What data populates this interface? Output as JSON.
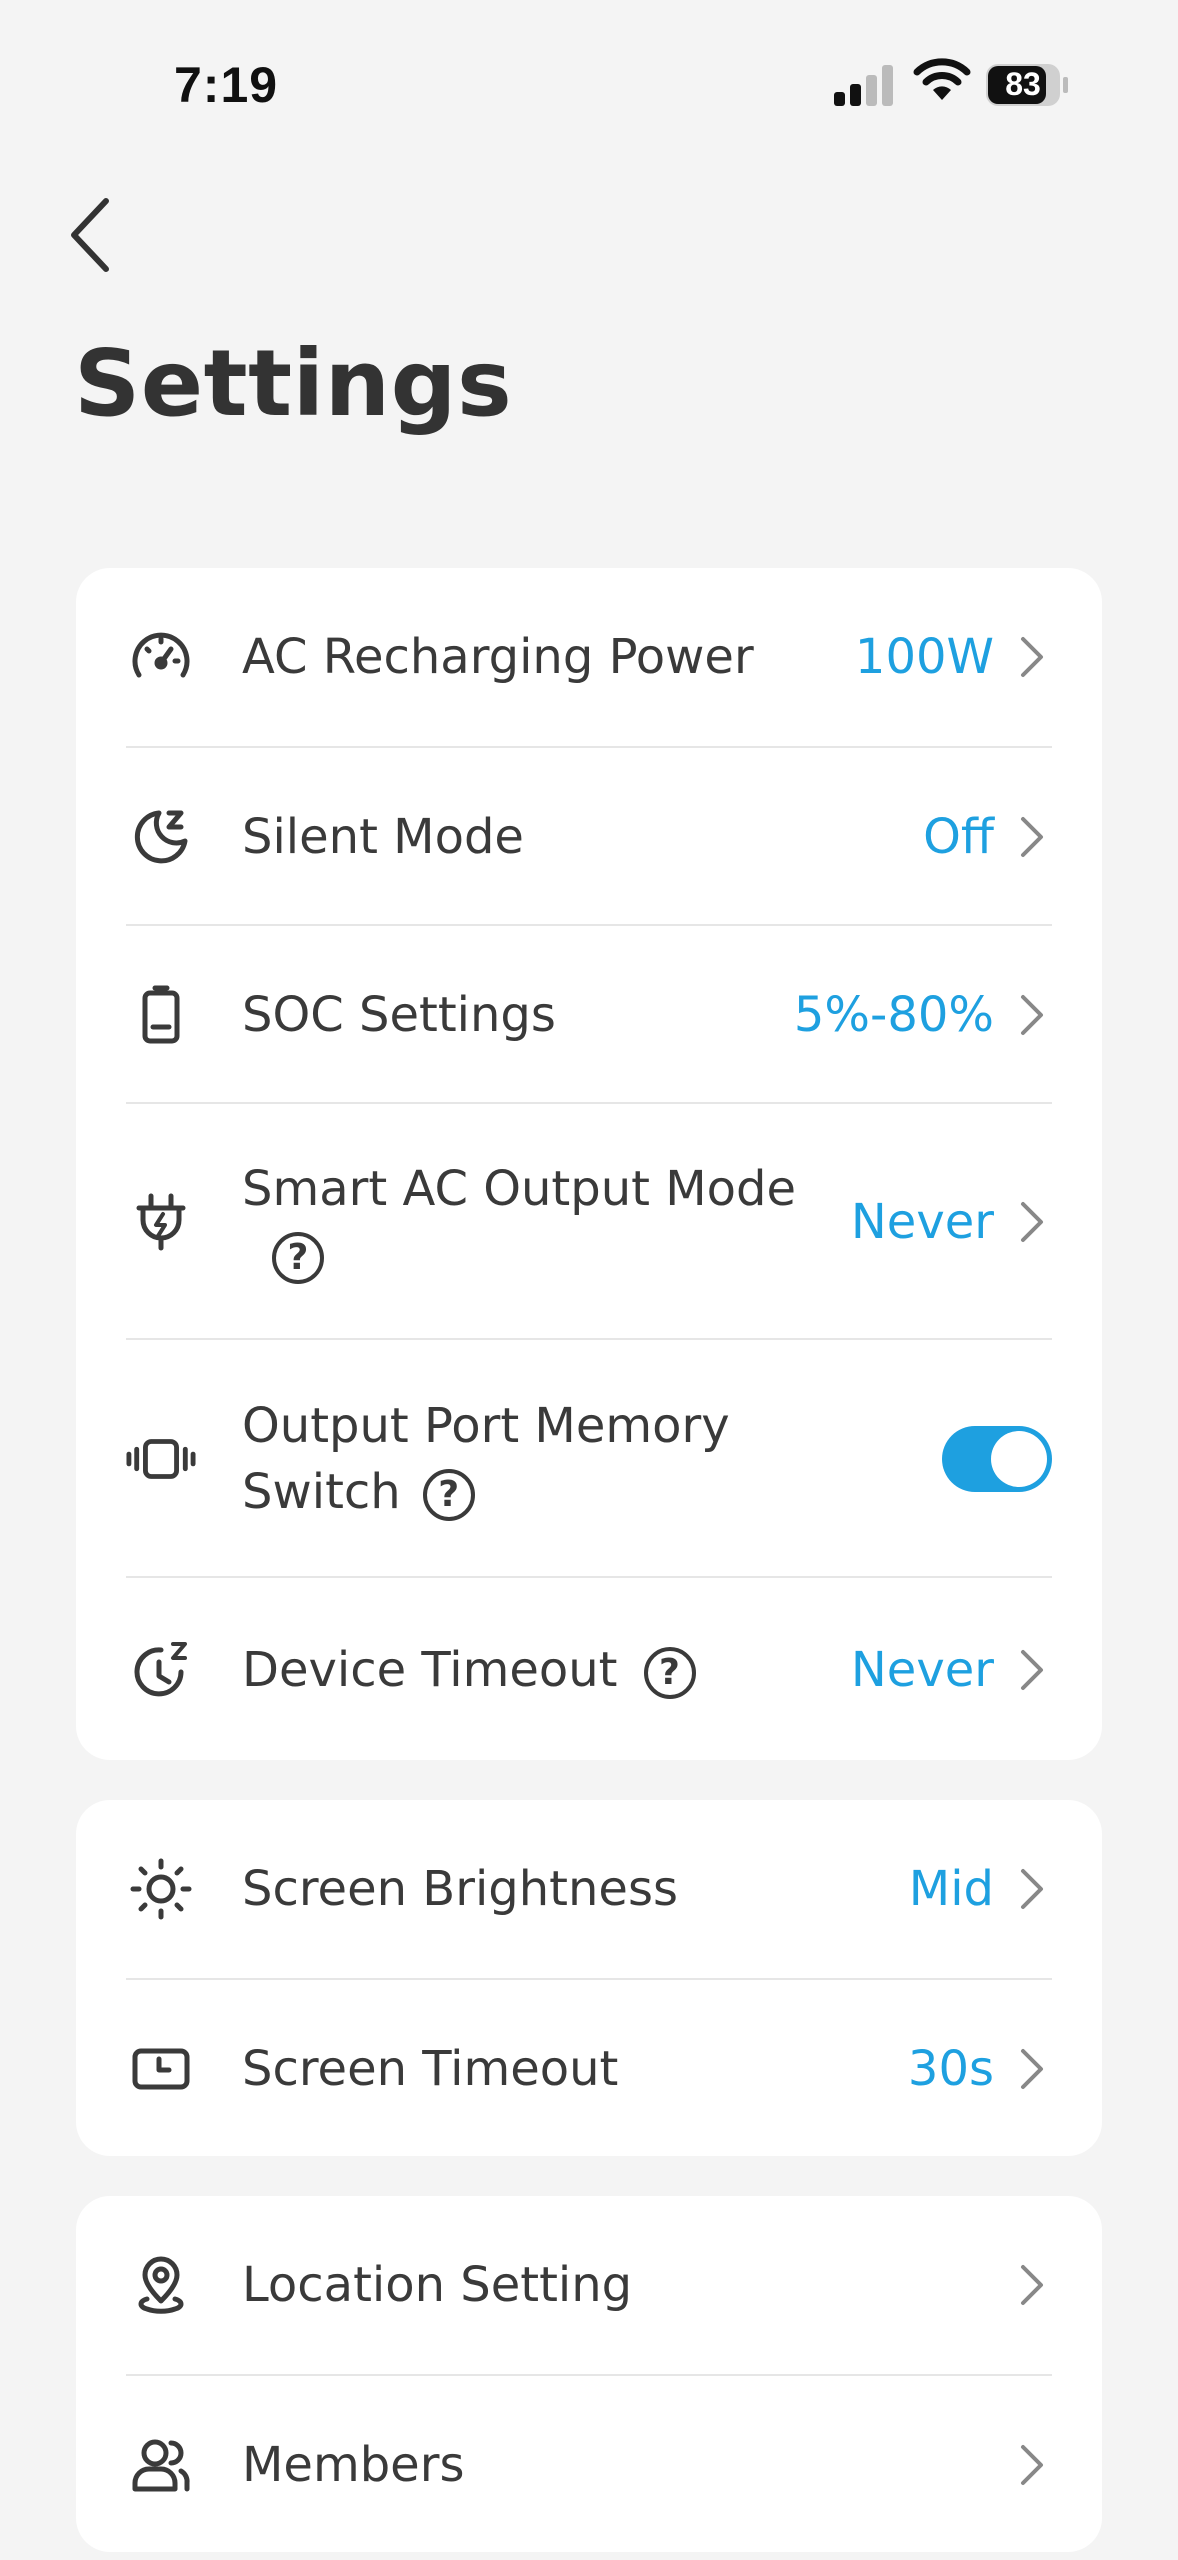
{
  "status_bar": {
    "time": "7:19",
    "battery": "83"
  },
  "header": {
    "title": "Settings"
  },
  "group1": [
    {
      "label": "AC Recharging Power",
      "value": "100W",
      "icon": "gauge-icon"
    },
    {
      "label": "Silent Mode",
      "value": "Off",
      "icon": "moon-sleep-icon"
    },
    {
      "label": "SOC Settings",
      "value": "5%-80%",
      "icon": "battery-icon"
    },
    {
      "label": "Smart AC Output Mode",
      "value": "Never",
      "icon": "plug-bolt-icon"
    },
    {
      "label_line1": "Output Port Memory",
      "label_line2": "Switch",
      "toggle_on": true,
      "icon": "vibrate-icon"
    },
    {
      "label": "Device Timeout",
      "value": "Never",
      "icon": "timer-sleep-icon"
    }
  ],
  "group2": [
    {
      "label": "Screen Brightness",
      "value": "Mid",
      "icon": "sun-icon"
    },
    {
      "label": "Screen Timeout",
      "value": "30s",
      "icon": "screen-timer-icon"
    }
  ],
  "group3": [
    {
      "label": "Location Setting",
      "icon": "location-pin-icon"
    },
    {
      "label": "Members",
      "icon": "members-icon"
    }
  ],
  "help_glyph": "?",
  "colors": {
    "accent": "#1ea0e0",
    "background": "#f4f4f4",
    "card": "#ffffff",
    "text": "#3a3a3a"
  }
}
